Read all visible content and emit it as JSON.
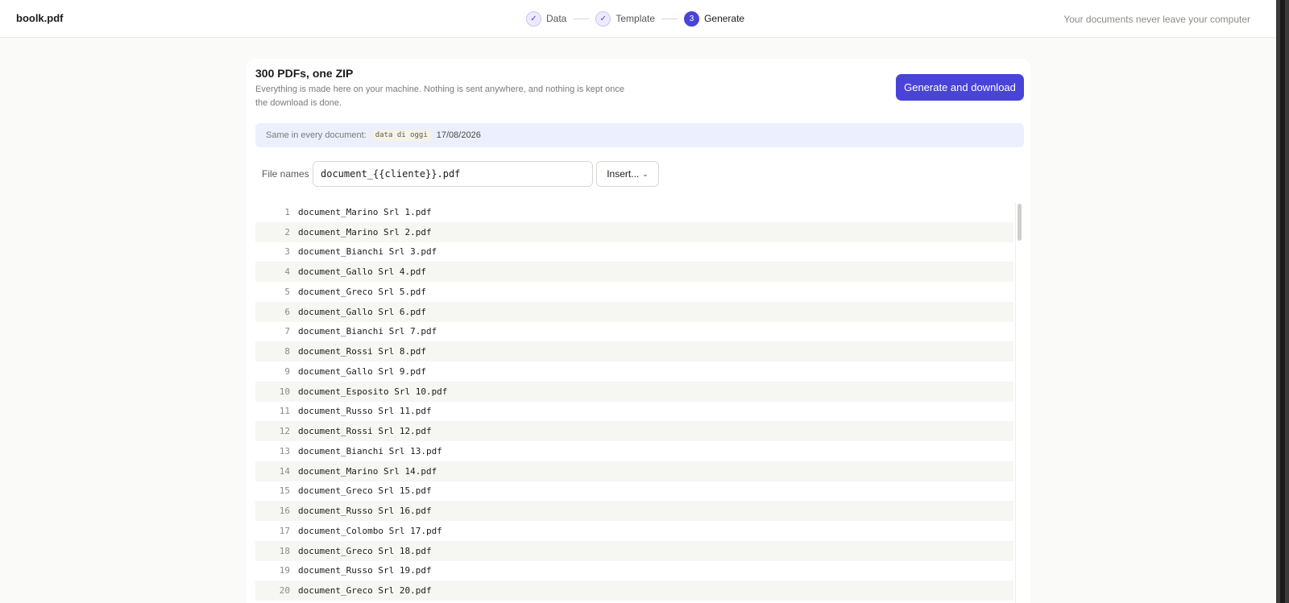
{
  "header": {
    "brand": "boolk.pdf",
    "privacy_note": "Your documents never leave your computer",
    "steps": [
      {
        "label": "Data",
        "state": "done",
        "marker": "✓"
      },
      {
        "label": "Template",
        "state": "done",
        "marker": "✓"
      },
      {
        "label": "Generate",
        "state": "active",
        "marker": "3"
      }
    ]
  },
  "panel": {
    "title": "300 PDFs, one ZIP",
    "description": "Everything is made here on your machine. Nothing is sent anywhere, and nothing is kept once the download is done.",
    "generate_label": "Generate and download",
    "constant": {
      "label": "Same in every document:",
      "key": "data di oggi",
      "value": "17/08/2026"
    },
    "filenames": {
      "label": "File names",
      "value": "document_{{cliente}}.pdf",
      "insert_label": "Insert..."
    },
    "rows": [
      {
        "n": "1",
        "name": "document_Marino Srl 1.pdf"
      },
      {
        "n": "2",
        "name": "document_Marino Srl 2.pdf"
      },
      {
        "n": "3",
        "name": "document_Bianchi Srl 3.pdf"
      },
      {
        "n": "4",
        "name": "document_Gallo Srl 4.pdf"
      },
      {
        "n": "5",
        "name": "document_Greco Srl 5.pdf"
      },
      {
        "n": "6",
        "name": "document_Gallo Srl 6.pdf"
      },
      {
        "n": "7",
        "name": "document_Bianchi Srl 7.pdf"
      },
      {
        "n": "8",
        "name": "document_Rossi Srl 8.pdf"
      },
      {
        "n": "9",
        "name": "document_Gallo Srl 9.pdf"
      },
      {
        "n": "10",
        "name": "document_Esposito Srl 10.pdf"
      },
      {
        "n": "11",
        "name": "document_Russo Srl 11.pdf"
      },
      {
        "n": "12",
        "name": "document_Rossi Srl 12.pdf"
      },
      {
        "n": "13",
        "name": "document_Bianchi Srl 13.pdf"
      },
      {
        "n": "14",
        "name": "document_Marino Srl 14.pdf"
      },
      {
        "n": "15",
        "name": "document_Greco Srl 15.pdf"
      },
      {
        "n": "16",
        "name": "document_Russo Srl 16.pdf"
      },
      {
        "n": "17",
        "name": "document_Colombo Srl 17.pdf"
      },
      {
        "n": "18",
        "name": "document_Greco Srl 18.pdf"
      },
      {
        "n": "19",
        "name": "document_Russo Srl 19.pdf"
      },
      {
        "n": "20",
        "name": "document_Greco Srl 20.pdf"
      }
    ]
  },
  "colors": {
    "accent": "#4a43d8",
    "constant_bg": "#eceffd",
    "row_alt": "#f6f6f3"
  },
  "icons": {
    "step_done": "check-icon",
    "insert_menu": "chevron-down-icon"
  }
}
